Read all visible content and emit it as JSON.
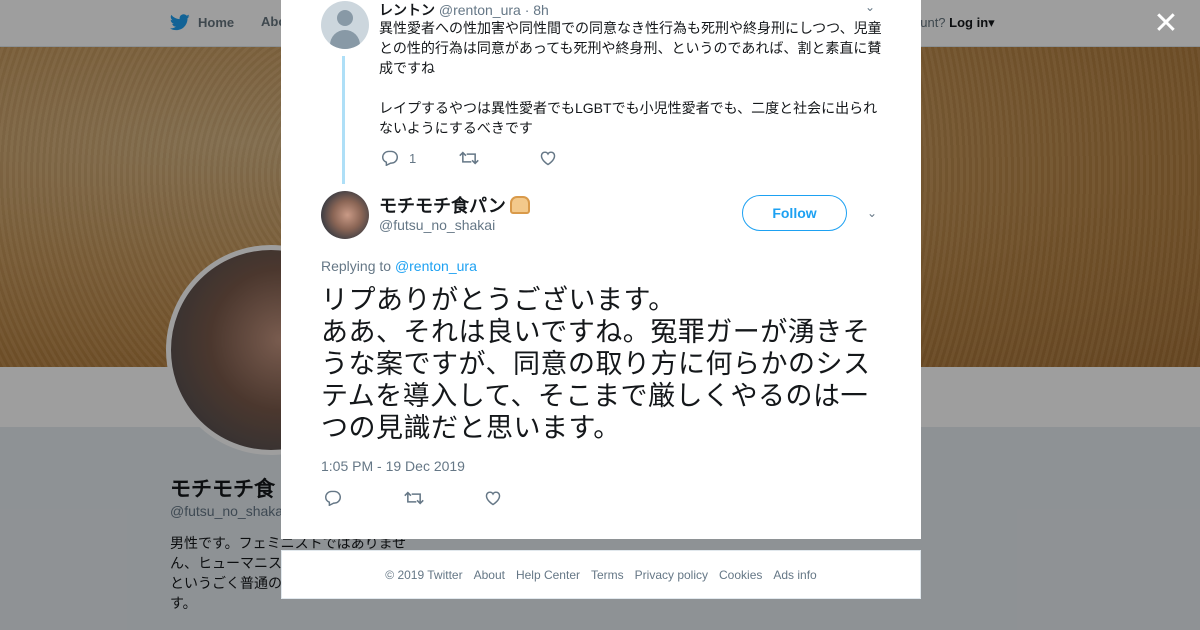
{
  "background": {
    "nav_home": "Home",
    "nav_about": "Abo",
    "nav_account": "ccount?",
    "nav_login": "Log in",
    "profile_name": "モチモチ食",
    "profile_handle": "@futsu_no_shaka",
    "profile_bio": "男性です。フェミニストではありません、ヒューマニス しつつ、人間とし る」というごく普通の社会を志向しています。"
  },
  "parent_tweet": {
    "name": "レントン",
    "handle": "@renton_ura",
    "time": "· 8h",
    "text": "異性愛者への性加害や同性間での同意なき性行為も死刑や終身刑にしつつ、児童との性的行為は同意があっても死刑や終身刑、というのであれば、割と素直に賛成ですね\n\nレイプするやつは異性愛者でもLGBTでも小児性愛者でも、二度と社会に出られないようにするべきです",
    "reply_count": "1"
  },
  "main_tweet": {
    "name": "モチモチ食パン",
    "handle": "@futsu_no_shakai",
    "follow_label": "Follow",
    "replying_prefix": "Replying to",
    "replying_handle": "@renton_ura",
    "text": "リプありがとうございます。\nああ、それは良いですね。冤罪ガーが湧きそうな案ですが、同意の取り方に何らかのシステムを導入して、そこまで厳しくやるのは一つの見識だと思います。",
    "timestamp": "1:05 PM - 19 Dec 2019"
  },
  "footer": {
    "links": [
      "© 2019 Twitter",
      "About",
      "Help Center",
      "Terms",
      "Privacy policy",
      "Cookies",
      "Ads info"
    ]
  },
  "colors": {
    "accent": "#1da1f2",
    "thread_line": "#aedff7",
    "text_primary": "#14171a",
    "text_secondary": "#657786"
  },
  "icons": {
    "close": "close-icon",
    "reply": "reply-icon",
    "retweet": "retweet-icon",
    "like": "heart-icon",
    "more": "chevron-down-icon",
    "bird": "twitter-bird-icon"
  }
}
